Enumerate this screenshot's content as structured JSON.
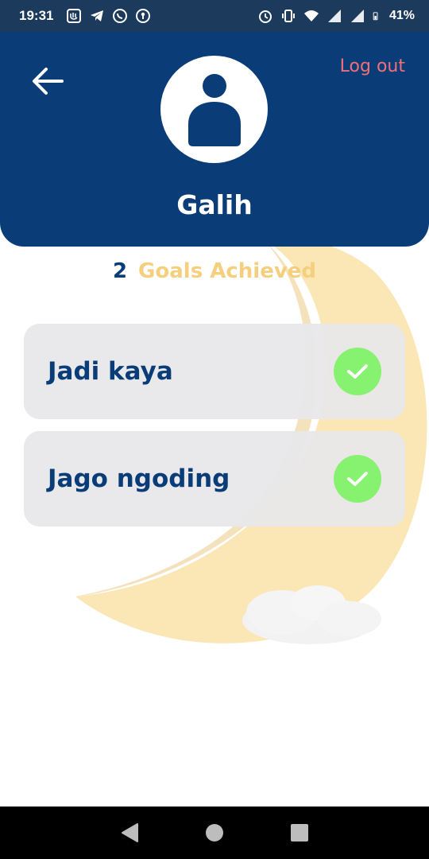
{
  "status_bar": {
    "time": "19:31",
    "notification_icons": [
      "app-badge-icon",
      "telegram-icon",
      "whatsapp-icon",
      "keyhole-icon"
    ],
    "system_icons": [
      "alarm-icon",
      "vibrate-icon",
      "wifi-icon",
      "signal-icon",
      "signal-icon",
      "battery-icon"
    ],
    "battery_percent": "41%"
  },
  "header": {
    "back_icon": "arrow-left-icon",
    "logout_label": "Log out",
    "avatar_icon": "user-icon",
    "username": "Galih"
  },
  "goals": {
    "count": "2",
    "label": "Goals Achieved",
    "items": [
      {
        "title": "Jadi kaya",
        "status_icon": "check-icon"
      },
      {
        "title": "Jago ngoding",
        "status_icon": "check-icon"
      }
    ]
  },
  "colors": {
    "primary": "#0a3d78",
    "accent_gold": "#f6cf7e",
    "logout": "#ef6f78",
    "check": "#86f26f",
    "card": "#e8e8ea"
  },
  "nav_bar": {
    "buttons": [
      "back-triangle-icon",
      "home-circle-icon",
      "recents-square-icon"
    ]
  }
}
